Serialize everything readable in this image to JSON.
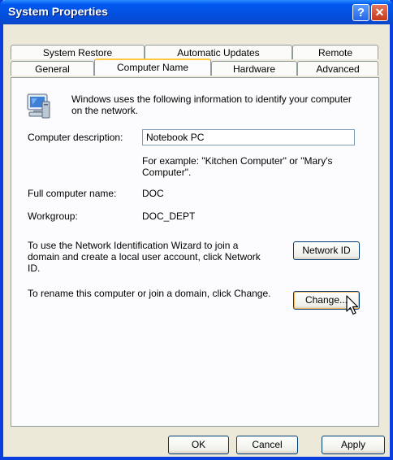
{
  "window": {
    "title": "System Properties"
  },
  "titlebar_buttons": {
    "help": "?",
    "close": "✕"
  },
  "tabs_row1": [
    "System Restore",
    "Automatic Updates",
    "Remote"
  ],
  "tabs_row2": [
    "General",
    "Computer Name",
    "Hardware",
    "Advanced"
  ],
  "active_tab": "Computer Name",
  "intro_text_line1": "Windows uses the following information to identify your computer",
  "intro_text_line2": "on the network.",
  "description": {
    "label": "Computer description:",
    "value": "Notebook PC",
    "example_line1": "For example: \"Kitchen Computer\" or \"Mary's",
    "example_line2": "Computer\"."
  },
  "full_name": {
    "label": "Full computer name:",
    "value": "DOC"
  },
  "workgroup": {
    "label": "Workgroup:",
    "value": "DOC_DEPT"
  },
  "network_id": {
    "text_line1": "To use the Network Identification Wizard to join a",
    "text_line2": "domain and create a local user account, click Network",
    "text_line3": "ID.",
    "button": "Network ID"
  },
  "change": {
    "text": "To rename this computer or join a domain, click Change.",
    "button": "Change..."
  },
  "footer": {
    "ok": "OK",
    "cancel": "Cancel",
    "apply": "Apply"
  },
  "icons": {
    "computer": "computer-icon",
    "cursor": "mouse-pointer-icon"
  }
}
